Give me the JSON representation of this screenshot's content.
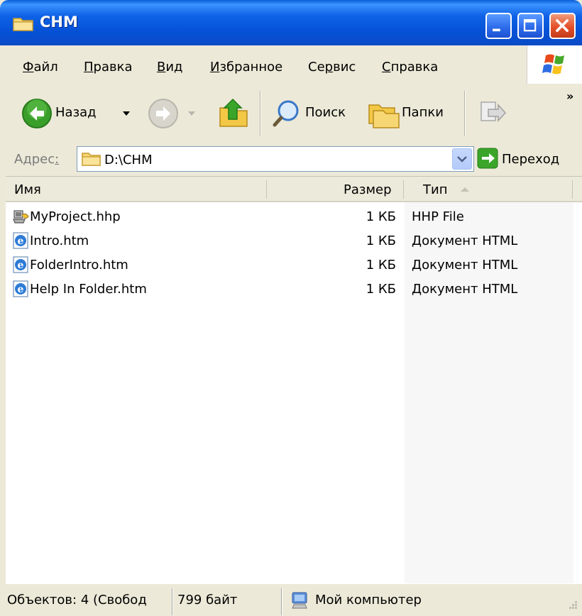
{
  "window": {
    "title": "CHM"
  },
  "menu": [
    {
      "label": "Файл",
      "accel": "Ф",
      "rest": "айл"
    },
    {
      "label": "Правка",
      "accel": "П",
      "rest": "равка"
    },
    {
      "label": "Вид",
      "accel": "В",
      "rest": "ид"
    },
    {
      "label": "Избранное",
      "accel": "И",
      "rest": "збранное"
    },
    {
      "label": "Сервис",
      "pre": "Се",
      "accel": "р",
      "rest": "вис"
    },
    {
      "label": "Справка",
      "accel": "С",
      "rest": "правка"
    }
  ],
  "toolbar": {
    "back_label": "Назад",
    "search_label": "Поиск",
    "folders_label": "Папки",
    "more": "»"
  },
  "address": {
    "label_pre": "Адрес",
    "label_accel": ":",
    "value": "D:\\CHM",
    "go_label": "Переход"
  },
  "columns": {
    "name": "Имя",
    "size": "Размер",
    "type": "Тип"
  },
  "files": [
    {
      "name": "MyProject.hhp",
      "size": "1 КБ",
      "type": "HHP File",
      "icon": "hhp-file-icon"
    },
    {
      "name": "Intro.htm",
      "size": "1 КБ",
      "type": "Документ HTML",
      "icon": "ie-html-icon"
    },
    {
      "name": "FolderIntro.htm",
      "size": "1 КБ",
      "type": "Документ HTML",
      "icon": "ie-html-icon"
    },
    {
      "name": "Help In Folder.htm",
      "size": "1 КБ",
      "type": "Документ HTML",
      "icon": "ie-html-icon"
    }
  ],
  "status": {
    "objects": "Объектов: 4 (Свобод",
    "size": "799 байт",
    "location": "Мой компьютер"
  },
  "colors": {
    "titlebar": "#0A55D8",
    "close": "#E4502A",
    "chrome": "#ECE9D8"
  }
}
